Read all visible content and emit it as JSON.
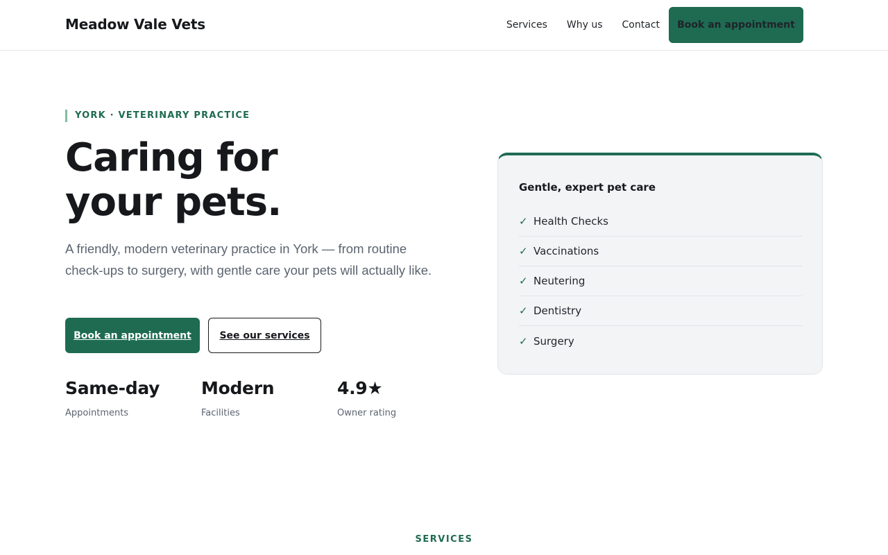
{
  "header": {
    "brand": "Meadow Vale Vets",
    "nav": [
      "Services",
      "Why us",
      "Contact"
    ],
    "cta": "Book an appointment"
  },
  "hero": {
    "eyebrow": "YORK · VETERINARY PRACTICE",
    "headline_line1": "Caring for",
    "headline_line2": "your pets.",
    "lead": "A friendly, modern veterinary practice in York — from routine check-ups to surgery, with gentle care your pets will actually like.",
    "primary_button": "Book an appointment",
    "secondary_button": "See our services",
    "stats": [
      {
        "value": "Same-day",
        "label": "Appointments"
      },
      {
        "value": "Modern",
        "label": "Facilities"
      },
      {
        "value": "4.9★",
        "label": "Owner rating"
      }
    ]
  },
  "card": {
    "title": "Gentle, expert pet care",
    "items": [
      "Health Checks",
      "Vaccinations",
      "Neutering",
      "Dentistry",
      "Surgery"
    ],
    "check_glyph": "✓"
  },
  "services_section": {
    "label": "SERVICES"
  },
  "colors": {
    "accent": "#1e6b52",
    "text": "#16181b",
    "muted": "#5b6470",
    "card_bg": "#f3f4f6"
  }
}
